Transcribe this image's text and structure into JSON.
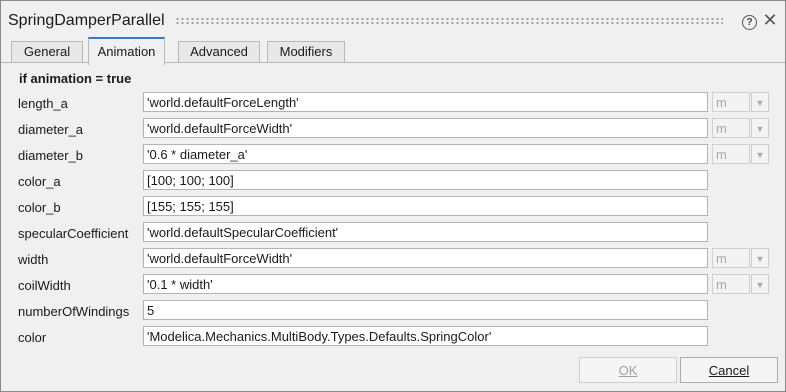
{
  "window": {
    "title": "SpringDamperParallel"
  },
  "tabs": [
    {
      "label": "General"
    },
    {
      "label": "Animation"
    },
    {
      "label": "Advanced"
    },
    {
      "label": "Modifiers"
    }
  ],
  "section": {
    "header": "if animation = true"
  },
  "params": [
    {
      "label": "length_a",
      "value": "'world.defaultForceLength'",
      "unit": "m"
    },
    {
      "label": "diameter_a",
      "value": "'world.defaultForceWidth'",
      "unit": "m"
    },
    {
      "label": "diameter_b",
      "value": "'0.6 * diameter_a'",
      "unit": "m"
    },
    {
      "label": "color_a",
      "value": "[100; 100; 100]"
    },
    {
      "label": "color_b",
      "value": "[155; 155; 155]"
    },
    {
      "label": "specularCoefficient",
      "value": "'world.defaultSpecularCoefficient'"
    },
    {
      "label": "width",
      "value": "'world.defaultForceWidth'",
      "unit": "m"
    },
    {
      "label": "coilWidth",
      "value": "'0.1 * width'",
      "unit": "m"
    },
    {
      "label": "numberOfWindings",
      "value": "5"
    },
    {
      "label": "color",
      "value": "'Modelica.Mechanics.MultiBody.Types.Defaults.SpringColor'"
    }
  ],
  "buttons": {
    "ok": "OK",
    "cancel": "Cancel"
  },
  "icons": {
    "help": "help-icon",
    "close": "close-icon",
    "dropdown": "chevron-down-icon"
  },
  "colors": {
    "active_tab_accent": "#3a78c9"
  }
}
